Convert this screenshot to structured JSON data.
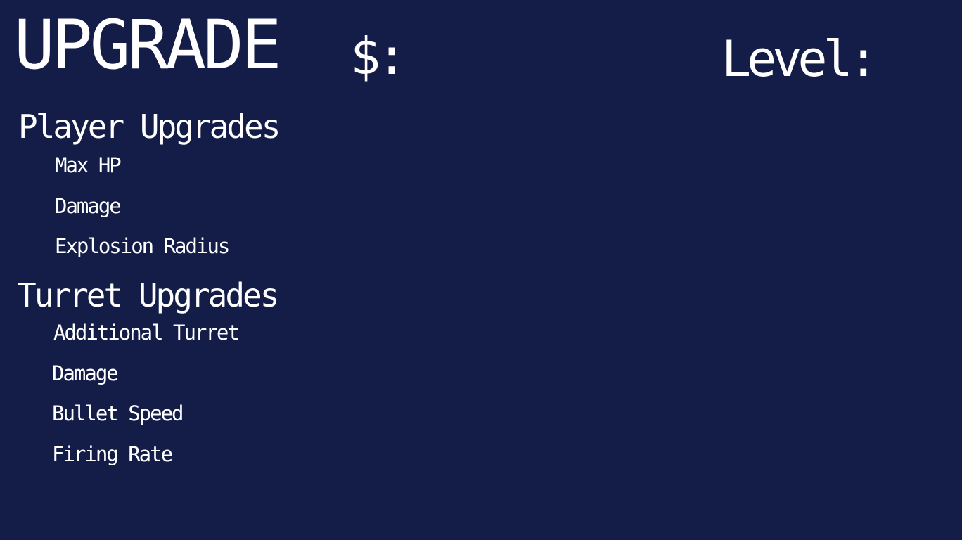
{
  "header": {
    "title": "UPGRADE",
    "money_label": "$:",
    "level_label": "Level:"
  },
  "player_upgrades": {
    "title": "Player Upgrades",
    "items": [
      {
        "label": "Max HP"
      },
      {
        "label": "Damage"
      },
      {
        "label": "Explosion Radius"
      }
    ]
  },
  "turret_upgrades": {
    "title": "Turret Upgrades",
    "items": [
      {
        "label": "Additional Turret"
      },
      {
        "label": "Damage"
      },
      {
        "label": "Bullet Speed"
      },
      {
        "label": "Firing Rate"
      }
    ]
  },
  "colors": {
    "background": "#141d47",
    "text": "#ffffff"
  }
}
